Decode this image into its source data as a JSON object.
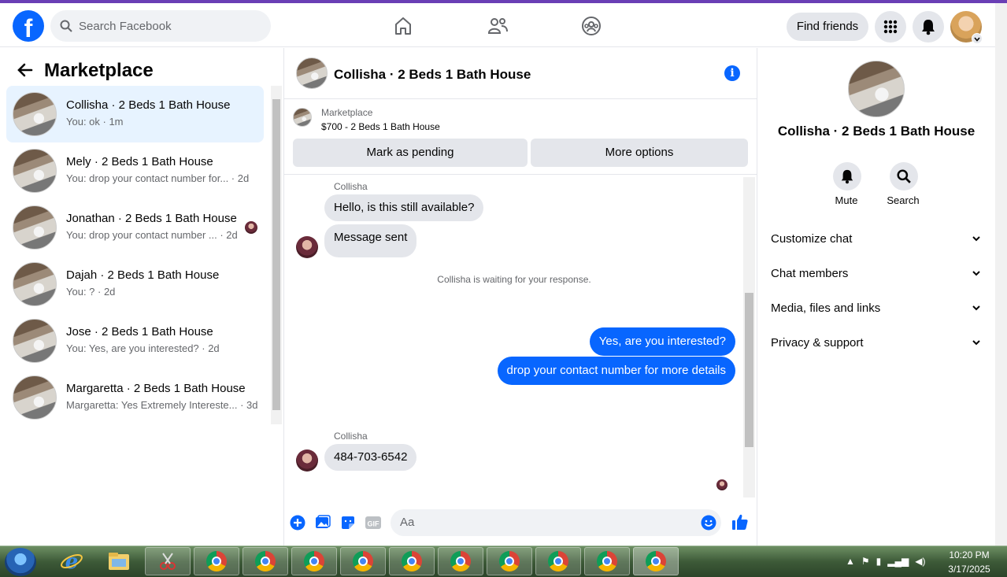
{
  "topbar": {
    "logo": "f",
    "search_placeholder": "Search Facebook",
    "find_friends": "Find friends"
  },
  "left_panel": {
    "title": "Marketplace",
    "conversations": [
      {
        "name": "Collisha · 2 Beds 1 Bath House",
        "sub": "You: ok · 1m"
      },
      {
        "name": "Mely · 2 Beds 1 Bath House",
        "sub": "You: drop your contact number for... · 2d"
      },
      {
        "name": "Jonathan · 2 Beds 1 Bath House",
        "sub": "You: drop your contact number ... · 2d"
      },
      {
        "name": "Dajah · 2 Beds 1 Bath House",
        "sub": "You: ? · 2d"
      },
      {
        "name": "Jose · 2 Beds 1 Bath House",
        "sub": "You: Yes, are you interested? · 2d"
      },
      {
        "name": "Margaretta · 2 Beds 1 Bath House",
        "sub": "Margaretta: Yes Extremely Intereste... · 3d"
      }
    ]
  },
  "chat": {
    "title": "Collisha · 2 Beds 1 Bath House",
    "marketplace_label": "Marketplace",
    "listing": "$700 - 2 Beds 1 Bath House",
    "mark_pending": "Mark as pending",
    "more_options": "More options",
    "messages": {
      "sender1": "Collisha",
      "in1": "Hello, is this still available?",
      "in2": "Message sent",
      "waiting": "Collisha is waiting for your response.",
      "out1": "Yes, are you interested?",
      "out2": "drop your contact number for more details",
      "sender2": "Collisha",
      "in3": "484-703-6542"
    },
    "composer_placeholder": "Aa"
  },
  "right_panel": {
    "title": "Collisha · 2 Beds 1 Bath House",
    "mute": "Mute",
    "search": "Search",
    "sections": [
      "Customize chat",
      "Chat members",
      "Media, files and links",
      "Privacy & support"
    ]
  },
  "taskbar": {
    "time": "10:20 PM",
    "date": "3/17/2025"
  },
  "colors": {
    "accent": "#0866ff",
    "active_conversation": "#e7f3ff"
  }
}
